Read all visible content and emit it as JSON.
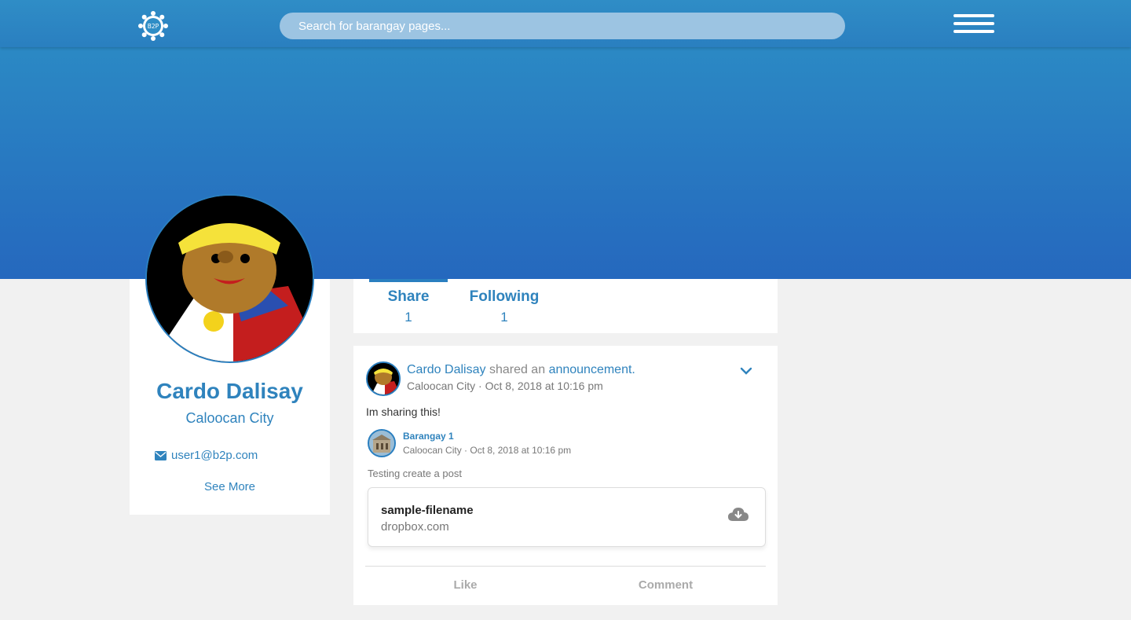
{
  "header": {
    "logo_text": "B2P",
    "search_placeholder": "Search for barangay pages...",
    "menu_icon": "hamburger-menu-icon"
  },
  "profile": {
    "name": "Cardo Dalisay",
    "city": "Caloocan City",
    "email": "user1@b2p.com",
    "see_more": "See More"
  },
  "stats": [
    {
      "label": "Share",
      "value": "1"
    },
    {
      "label": "Following",
      "value": "1"
    }
  ],
  "post": {
    "author": "Cardo Dalisay",
    "action_text": "shared an",
    "action_link": "announcement.",
    "meta": "Caloocan City · Oct 8, 2018 at 10:16 pm",
    "text": "Im sharing this!",
    "shared": {
      "name": "Barangay 1",
      "meta": "Caloocan City · Oct 8, 2018 at 10:16 pm",
      "text": "Testing create a post"
    },
    "file": {
      "name": "sample-filename",
      "host": "dropbox.com"
    },
    "like_label": "Like",
    "comment_label": "Comment"
  },
  "colors": {
    "accent": "#2f83bd",
    "header": "#2f8dc6",
    "cover_top": "#2b89c4",
    "cover_bottom": "#2568be"
  }
}
